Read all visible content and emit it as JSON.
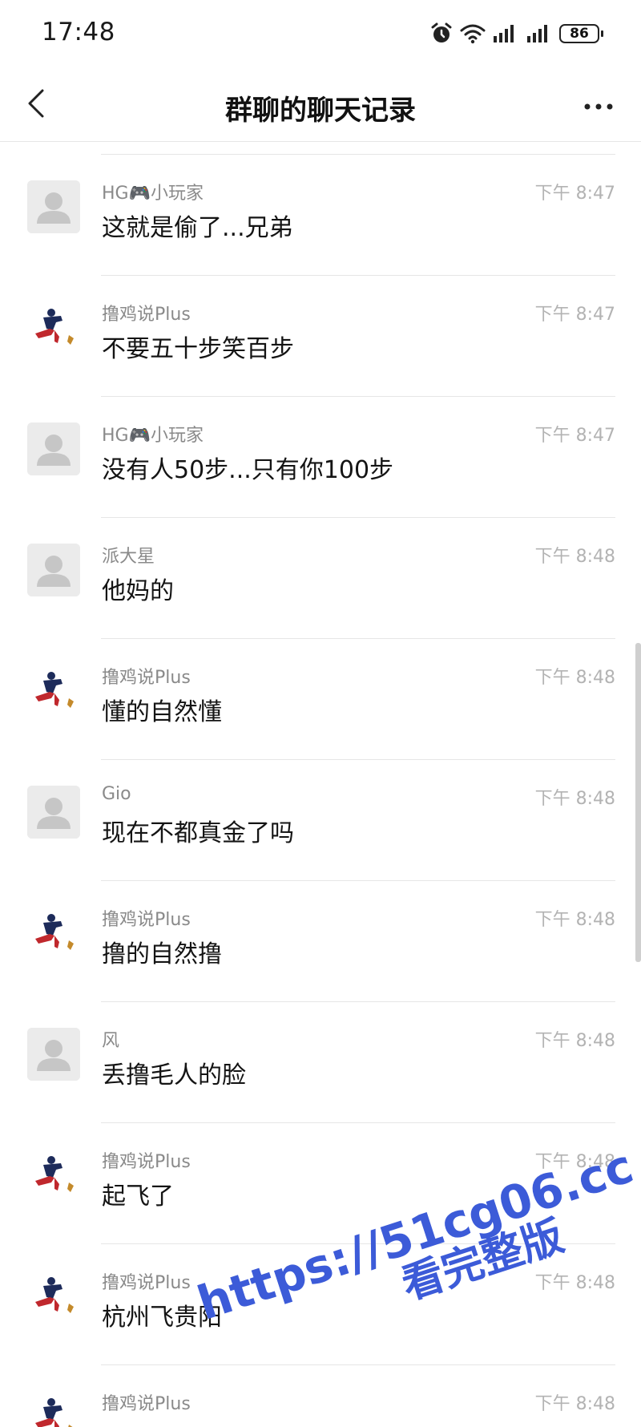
{
  "status_bar": {
    "time": "17:48",
    "battery": "86",
    "icons": [
      "alarm-icon",
      "wifi-icon",
      "signal-icon",
      "signal-icon-2",
      "battery-icon"
    ]
  },
  "nav": {
    "title": "群聊的聊天记录",
    "back_icon": "chevron-left-icon",
    "more_icon": "more-dots-icon"
  },
  "messages": [
    {
      "sender": "HG🎮小玩家",
      "time": "下午 8:47",
      "text": "这就是偷了...兄弟",
      "avatar": "default"
    },
    {
      "sender": "撸鸡说Plus",
      "time": "下午 8:47",
      "text": "不要五十步笑百步",
      "avatar": "figure"
    },
    {
      "sender": "HG🎮小玩家",
      "time": "下午 8:47",
      "text": "没有人50步...只有你100步",
      "avatar": "default"
    },
    {
      "sender": "派大星",
      "time": "下午 8:48",
      "text": "他妈的",
      "avatar": "default"
    },
    {
      "sender": "撸鸡说Plus",
      "time": "下午 8:48",
      "text": "懂的自然懂",
      "avatar": "figure"
    },
    {
      "sender": "Gio",
      "time": "下午 8:48",
      "text": "现在不都真金了吗",
      "avatar": "default"
    },
    {
      "sender": "撸鸡说Plus",
      "time": "下午 8:48",
      "text": "撸的自然撸",
      "avatar": "figure"
    },
    {
      "sender": "风",
      "time": "下午 8:48",
      "text": "丢撸毛人的脸",
      "avatar": "default"
    },
    {
      "sender": "撸鸡说Plus",
      "time": "下午 8:48",
      "text": "起飞了",
      "avatar": "figure"
    },
    {
      "sender": "撸鸡说Plus",
      "time": "下午 8:48",
      "text": "杭州飞贵阳",
      "avatar": "figure"
    },
    {
      "sender": "撸鸡说Plus",
      "time": "下午 8:48",
      "text": "",
      "avatar": "figure"
    }
  ],
  "watermark": {
    "url": "https://51cg06.cc",
    "subtitle": "看完整版"
  },
  "colors": {
    "accent_watermark": "#3c5bd8",
    "sender_gray": "#8a8a8a",
    "time_gray": "#b3b3b3",
    "divider": "#e6e6e6"
  }
}
